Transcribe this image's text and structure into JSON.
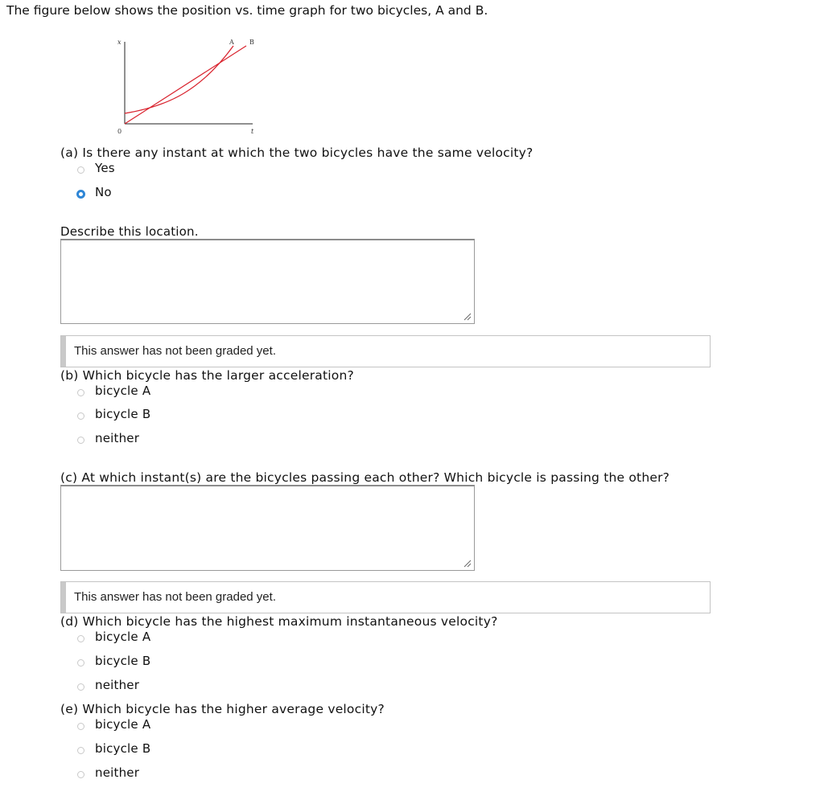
{
  "intro": "The figure below shows the position vs. time graph for two bicycles, A and B.",
  "figure": {
    "y_axis_label": "x",
    "x_axis_label": "t",
    "origin_label": "0",
    "curve_a_label": "A",
    "curve_b_label": "B",
    "line_color": "#d9232e"
  },
  "part_a": {
    "question": "(a) Is there any instant at which the two bicycles have the same velocity?",
    "options": [
      {
        "label": "Yes",
        "selected": false
      },
      {
        "label": "No",
        "selected": true
      }
    ],
    "describe_label": "Describe this location.",
    "answer_value": "",
    "graded_message": "This answer has not been graded yet."
  },
  "part_b": {
    "question": "(b) Which bicycle has the larger acceleration?",
    "options": [
      {
        "label": "bicycle A",
        "selected": false
      },
      {
        "label": "bicycle B",
        "selected": false
      },
      {
        "label": "neither",
        "selected": false
      }
    ]
  },
  "part_c": {
    "question": "(c) At which instant(s) are the bicycles passing each other? Which bicycle is passing the other?",
    "answer_value": "",
    "graded_message": "This answer has not been graded yet."
  },
  "part_d": {
    "question": "(d) Which bicycle has the highest maximum instantaneous velocity?",
    "options": [
      {
        "label": "bicycle A",
        "selected": false
      },
      {
        "label": "bicycle B",
        "selected": false
      },
      {
        "label": "neither",
        "selected": false
      }
    ]
  },
  "part_e": {
    "question": "(e) Which bicycle has the higher average velocity?",
    "options": [
      {
        "label": "bicycle A",
        "selected": false
      },
      {
        "label": "bicycle B",
        "selected": false
      },
      {
        "label": "neither",
        "selected": false
      }
    ]
  },
  "colors": {
    "selected_radio": "#2f86d6",
    "graph_line": "#d9232e"
  }
}
